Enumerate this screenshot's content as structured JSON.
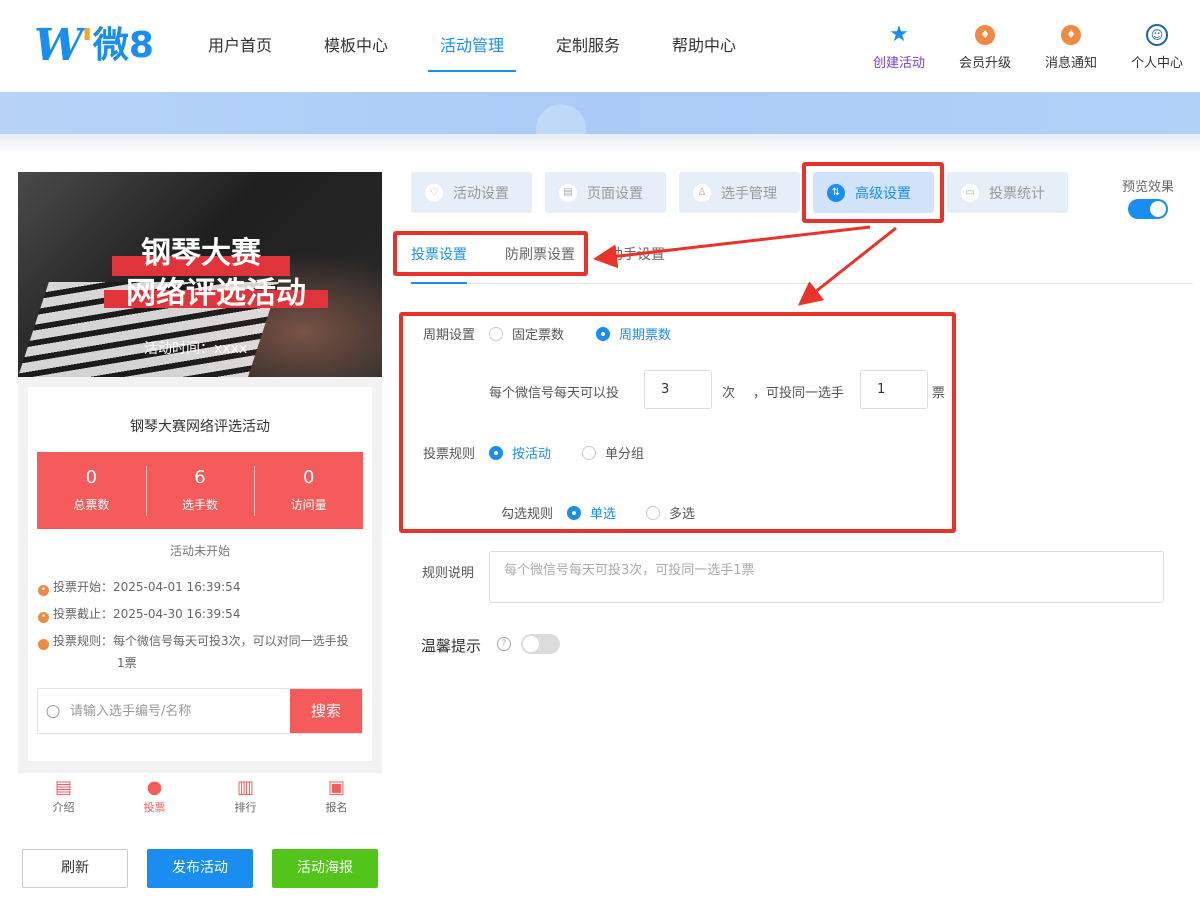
{
  "logo": {
    "w": "W",
    "text": "微8"
  },
  "nav": [
    "用户首页",
    "模板中心",
    "活动管理",
    "定制服务",
    "帮助中心"
  ],
  "header_actions": {
    "create": "创建活动",
    "upgrade": "会员升级",
    "notify": "消息通知",
    "profile": "个人中心"
  },
  "preview_card": {
    "cover_title_line1": "钢琴大赛",
    "cover_title_line2": "网络评选活动",
    "cover_time": "活动时间：xxxx",
    "title": "钢琴大赛网络评选活动",
    "stats": [
      {
        "value": "0",
        "label": "总票数"
      },
      {
        "value": "6",
        "label": "选手数"
      },
      {
        "value": "0",
        "label": "访问量"
      }
    ],
    "status": "活动未开始",
    "vote_start": "投票开始：2025-04-01 16:39:54",
    "vote_end": "投票截止：2025-04-30 16:39:54",
    "vote_rule": "投票规则：每个微信号每天可投3次，可以对同一选手投1票",
    "search_placeholder": "请输入选手编号/名称",
    "search_button": "搜索"
  },
  "bottom_tabs": [
    "介绍",
    "投票",
    "排行",
    "报名"
  ],
  "bottom_buttons": {
    "refresh": "刷新",
    "publish": "发布活动",
    "poster": "活动海报"
  },
  "settings_tabs": [
    "活动设置",
    "页面设置",
    "选手管理",
    "高级设置",
    "投票统计"
  ],
  "preview_effect": "预览效果",
  "sub_tabs": [
    "投票设置",
    "防刷票设置",
    "助手设置"
  ],
  "form": {
    "period_label": "周期设置",
    "period_options": [
      "固定票数",
      "周期票数"
    ],
    "per_day_prefix": "每个微信号每天可以投",
    "per_day_value": "3",
    "times_unit": "次",
    "same_player_text": "，可投同一选手",
    "same_player_value": "1",
    "ticket_unit": "票",
    "vote_rule_label": "投票规则",
    "vote_rule_options": [
      "按活动",
      "单分组"
    ],
    "select_rule_label": "勾选规则",
    "select_rule_options": [
      "单选",
      "多选"
    ],
    "rule_desc_label": "规则说明",
    "rule_desc_placeholder": "每个微信号每天可投3次，可投同一选手1票",
    "tip_label": "温馨提示"
  },
  "colors": {
    "accent": "#1a8df0",
    "red": "#f55b5b",
    "annotation": "#e8332a",
    "green": "#52c41a"
  }
}
